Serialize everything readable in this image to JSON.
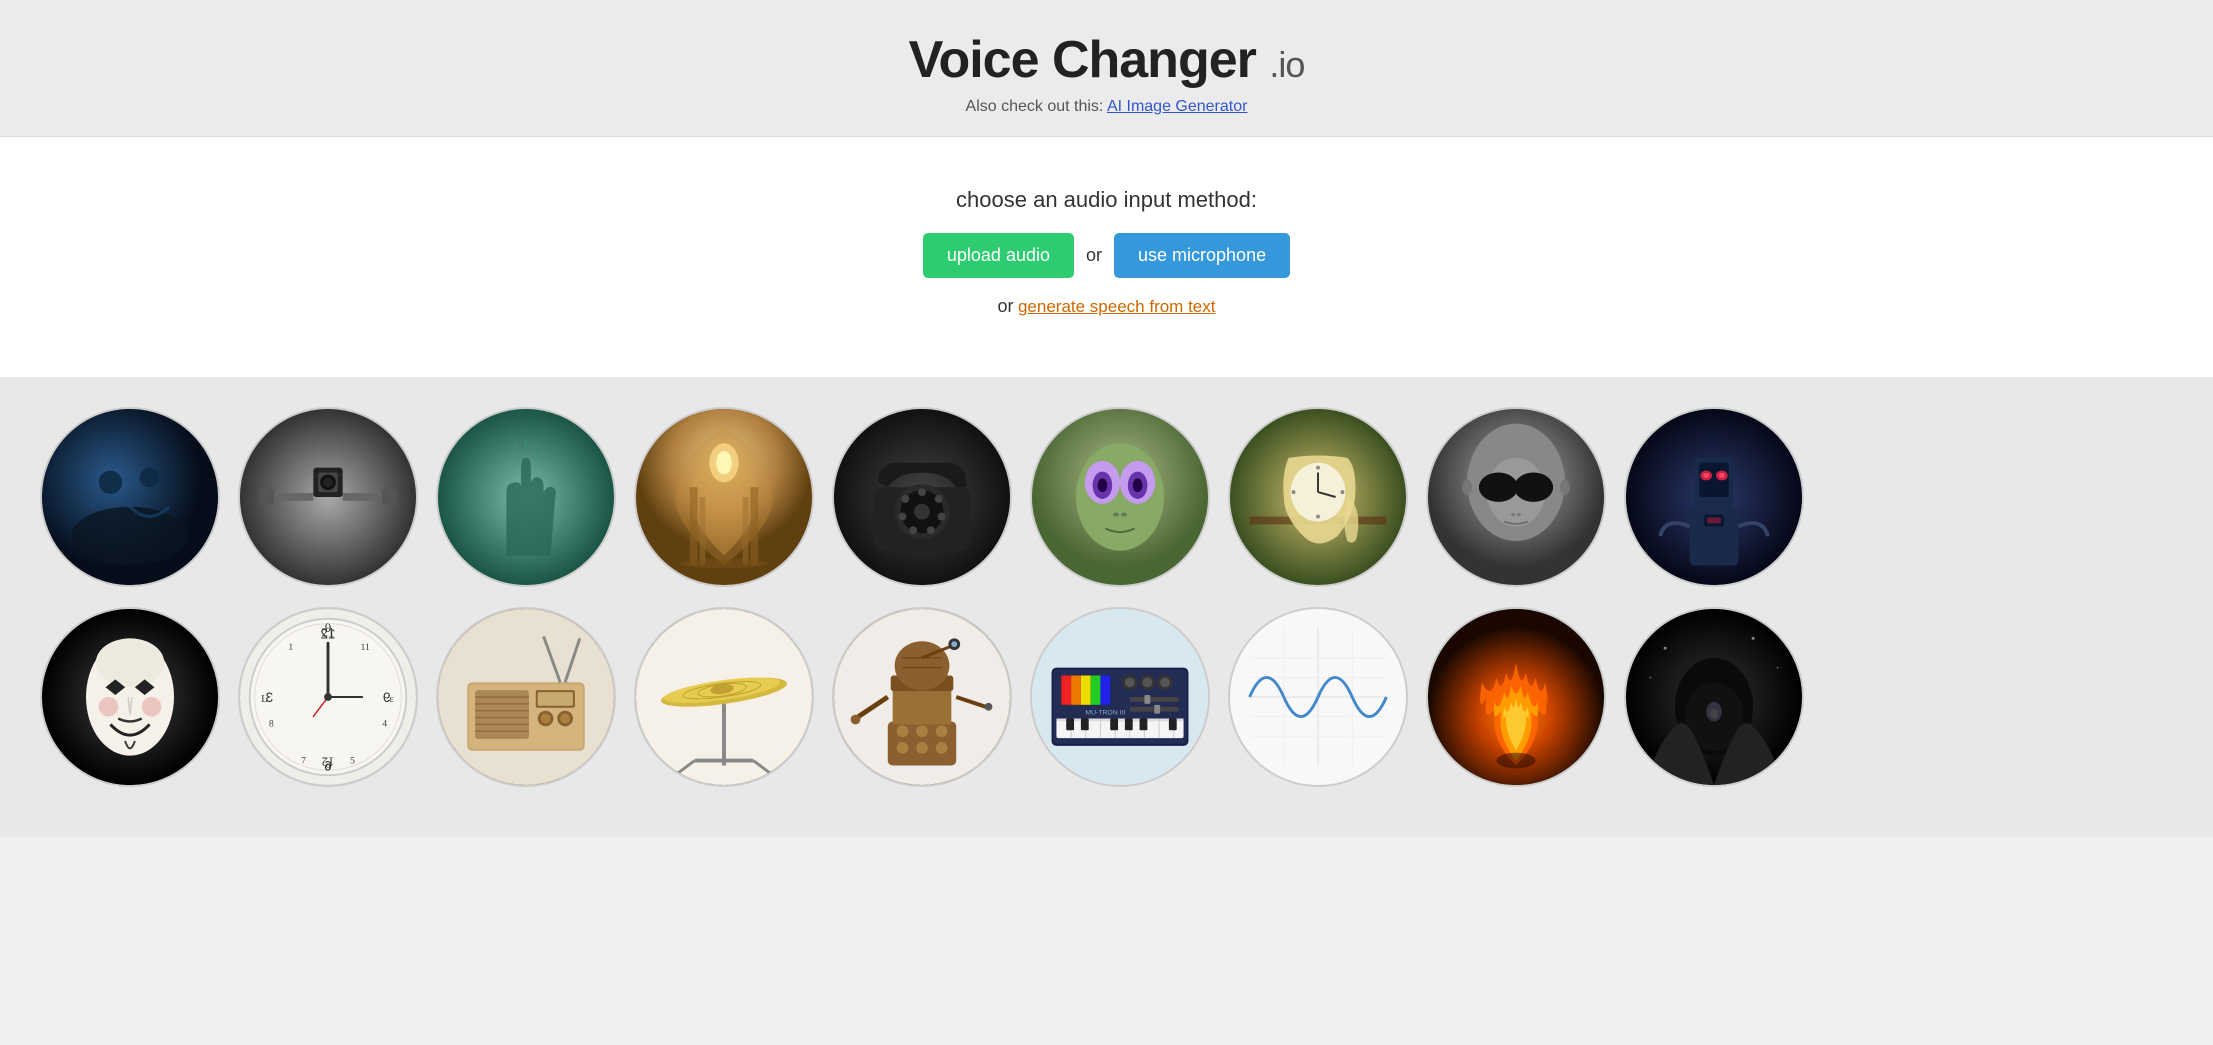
{
  "header": {
    "title": "Voice Changer",
    "tld": ".io",
    "subtitle_prefix": "Also check out this: ",
    "subtitle_link_text": "AI Image Generator",
    "subtitle_link_url": "#"
  },
  "main": {
    "choose_label": "choose an audio input method:",
    "upload_button": "upload audio",
    "or_text": "or",
    "microphone_button": "use microphone",
    "or2_text": "or",
    "generate_link": "generate speech from text"
  },
  "circles_row1": [
    {
      "id": "c1",
      "label": "Monster"
    },
    {
      "id": "c2",
      "label": "Robot Arms"
    },
    {
      "id": "c3",
      "label": "Ghost Hand"
    },
    {
      "id": "c4",
      "label": "Cathedral"
    },
    {
      "id": "c5",
      "label": "Old Phone"
    },
    {
      "id": "c6",
      "label": "Alien"
    },
    {
      "id": "c7",
      "label": "Melting Clock"
    },
    {
      "id": "c8",
      "label": "Gray Alien"
    },
    {
      "id": "c9",
      "label": "Cyborg"
    }
  ],
  "circles_row2": [
    {
      "id": "c10",
      "label": "Guy Fawkes"
    },
    {
      "id": "c11",
      "label": "Clock"
    },
    {
      "id": "c12",
      "label": "Radio"
    },
    {
      "id": "c13",
      "label": "Cymbal"
    },
    {
      "id": "c14",
      "label": "Dalek"
    },
    {
      "id": "c16",
      "label": "Synth"
    },
    {
      "id": "c17",
      "label": "Wave"
    },
    {
      "id": "c18",
      "label": "Fire"
    },
    {
      "id": "c19",
      "label": "Cave"
    }
  ]
}
